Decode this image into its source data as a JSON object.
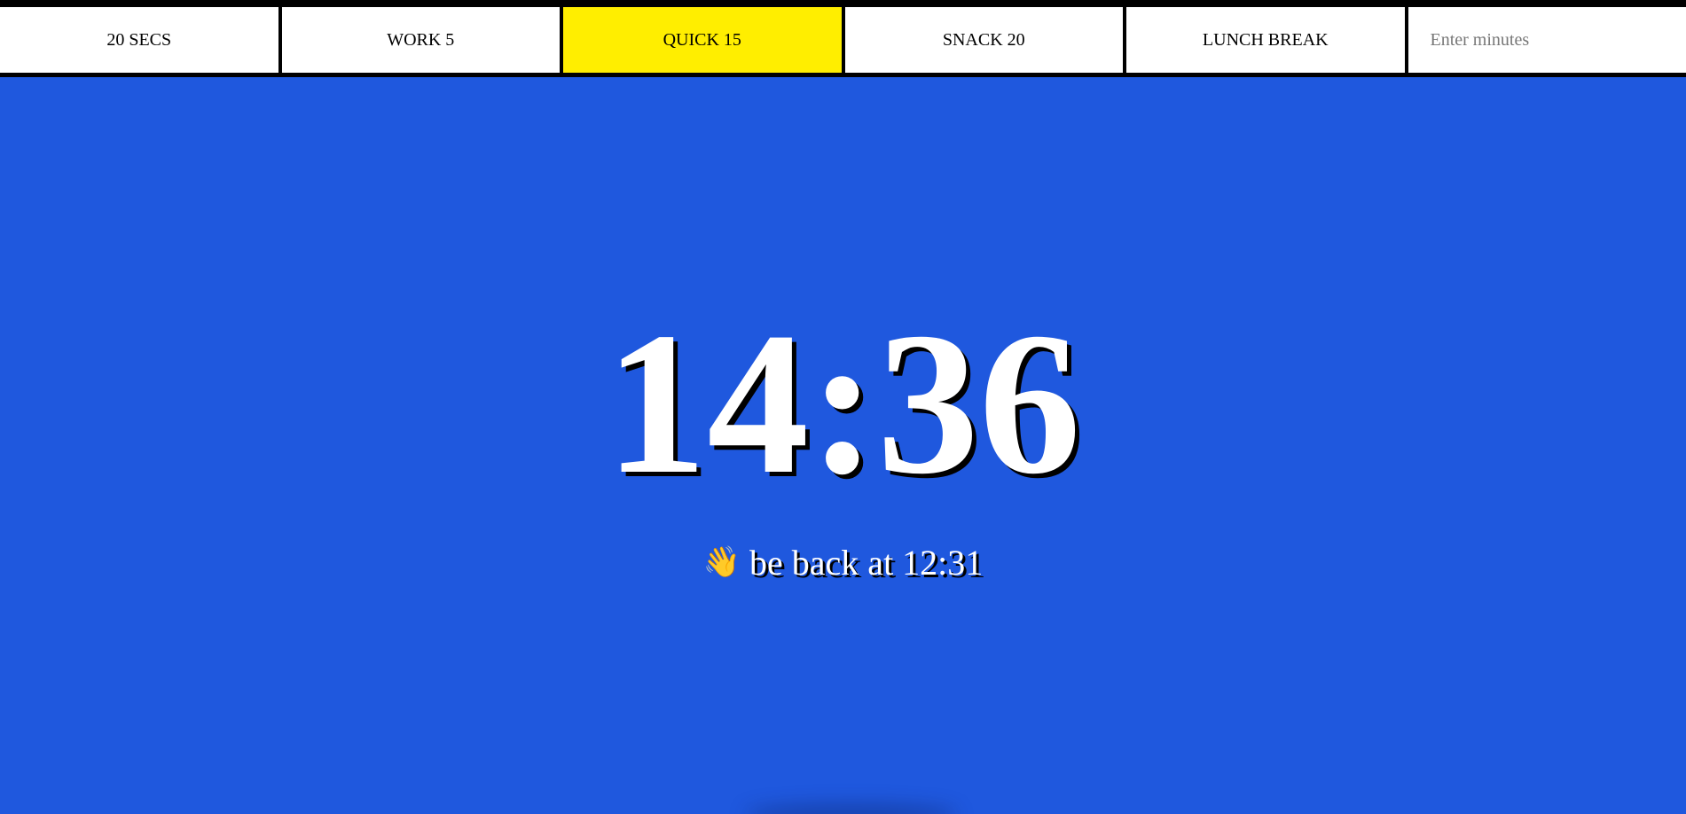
{
  "colors": {
    "background": "#1f58de",
    "active_button": "#ffee00",
    "button": "#ffffff",
    "bar": "#000000",
    "text": "#ffffff"
  },
  "buttons": [
    {
      "label": "20 SECS",
      "active": false
    },
    {
      "label": "WORK 5",
      "active": false
    },
    {
      "label": "QUICK 15",
      "active": true
    },
    {
      "label": "SNACK 20",
      "active": false
    },
    {
      "label": "LUNCH BREAK",
      "active": false
    }
  ],
  "custom_input": {
    "placeholder": "Enter minutes",
    "value": ""
  },
  "display": {
    "time_left": "14:36",
    "end_time_icon": "waving-hand-icon",
    "end_time_text": "be back at 12:31"
  }
}
